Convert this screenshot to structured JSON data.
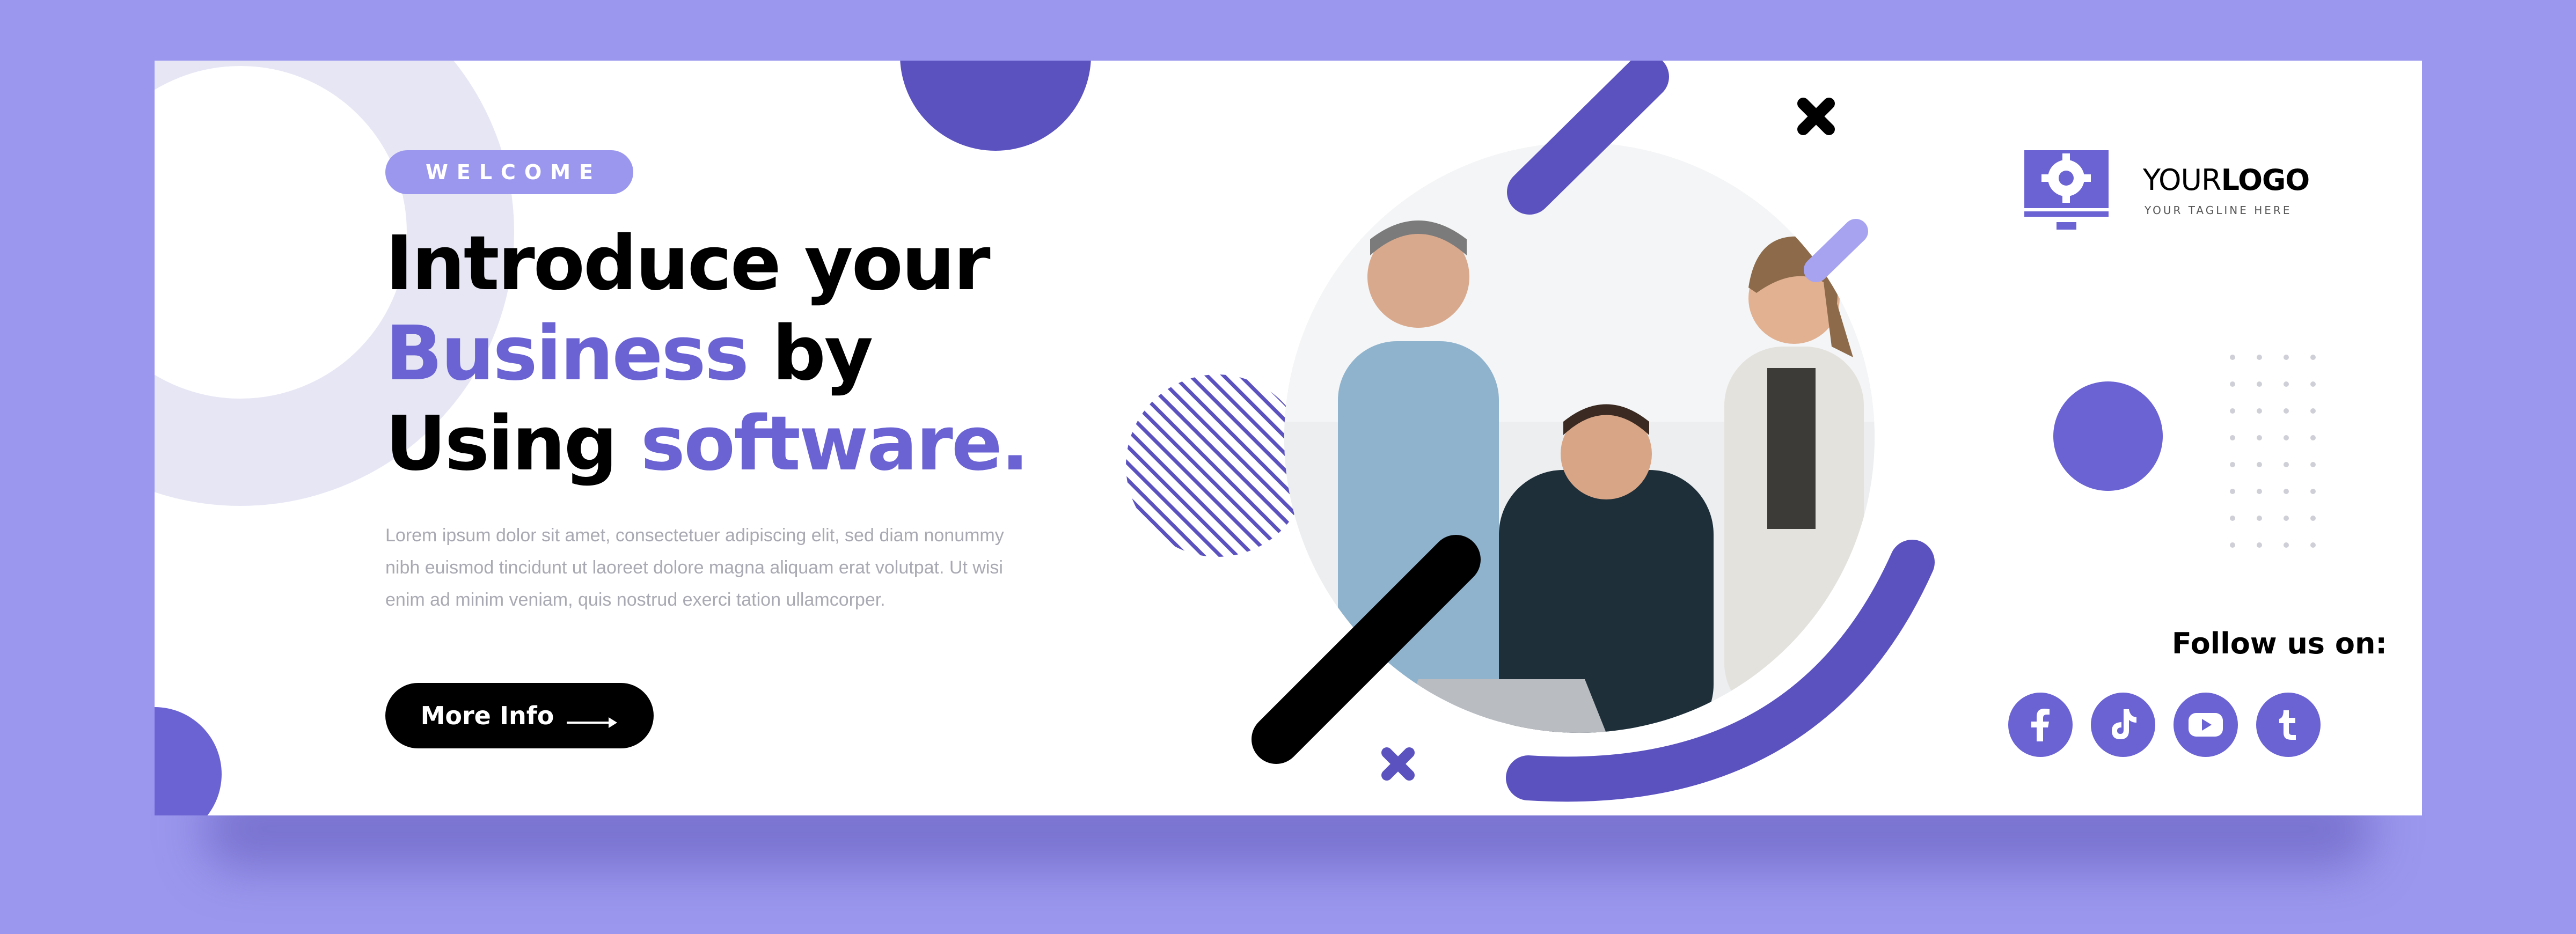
{
  "colors": {
    "page_background": "#9b97ee",
    "accent": "#6b63d3",
    "accent_dark": "#5b52c0",
    "text_dark": "#000000",
    "text_muted": "#a9a9b3"
  },
  "hero": {
    "badge": "WELCOME",
    "headline": {
      "line1": "Introduce your",
      "line2_accent": "Business",
      "line2_rest": " by",
      "line3_start": "Using ",
      "line3_accent": "software."
    },
    "body": "Lorem ipsum dolor sit amet, consectetuer adipiscing elit, sed diam nonummy nibh euismod tincidunt ut laoreet dolore magna aliquam erat volutpat. Ut wisi enim ad minim veniam, quis nostrud exerci tation ullamcorper.",
    "cta_label": "More Info"
  },
  "brand": {
    "logo_word": "YOUR",
    "logo_bold": "LOGO",
    "tagline": "YOUR TAGLINE HERE",
    "logo_icon": "monitor-gear-icon"
  },
  "social": {
    "heading": "Follow us on:",
    "icons": [
      "facebook-icon",
      "tiktok-icon",
      "youtube-icon",
      "tumblr-icon"
    ]
  }
}
